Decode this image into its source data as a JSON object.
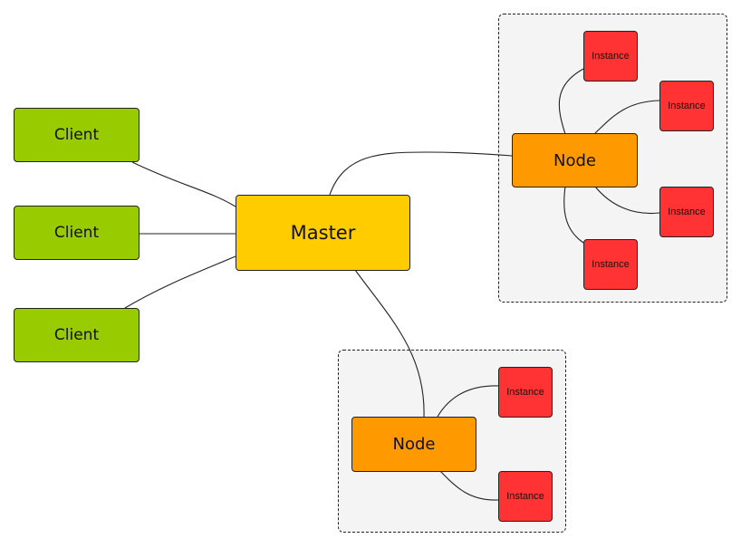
{
  "diagram": {
    "master": {
      "label": "Master",
      "color": "#ffcc00"
    },
    "clients": [
      {
        "label": "Client",
        "color": "#99cc00"
      },
      {
        "label": "Client",
        "color": "#99cc00"
      },
      {
        "label": "Client",
        "color": "#99cc00"
      }
    ],
    "nodes": [
      {
        "label": "Node",
        "color": "#ff9900",
        "instances": [
          {
            "label": "Instance"
          },
          {
            "label": "Instance"
          },
          {
            "label": "Instance"
          },
          {
            "label": "Instance"
          }
        ]
      },
      {
        "label": "Node",
        "color": "#ff9900",
        "instances": [
          {
            "label": "Instance"
          },
          {
            "label": "Instance"
          }
        ]
      }
    ],
    "instance_color": "#ff3333",
    "group_background": "#f4f4f4",
    "edges": [
      {
        "from": "client-1",
        "to": "master"
      },
      {
        "from": "client-2",
        "to": "master"
      },
      {
        "from": "client-3",
        "to": "master"
      },
      {
        "from": "master",
        "to": "node-1"
      },
      {
        "from": "master",
        "to": "node-2"
      },
      {
        "from": "node-1",
        "to": "node-1-instance-1"
      },
      {
        "from": "node-1",
        "to": "node-1-instance-2"
      },
      {
        "from": "node-1",
        "to": "node-1-instance-3"
      },
      {
        "from": "node-1",
        "to": "node-1-instance-4"
      },
      {
        "from": "node-2",
        "to": "node-2-instance-1"
      },
      {
        "from": "node-2",
        "to": "node-2-instance-2"
      }
    ]
  }
}
